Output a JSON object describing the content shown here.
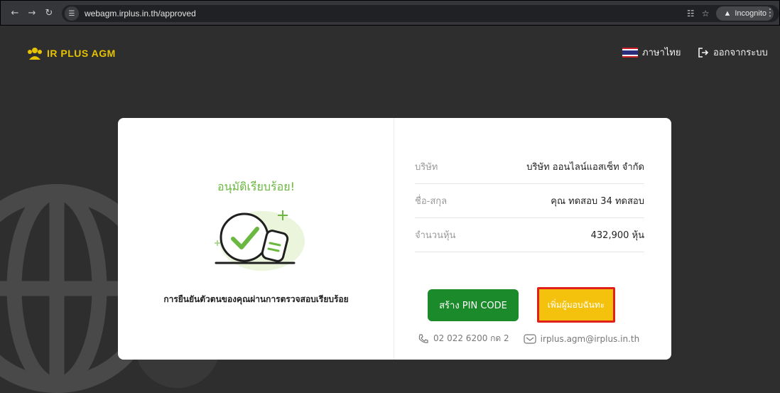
{
  "browser": {
    "url": "webagm.irplus.in.th/approved",
    "incognito_label": "Incognito"
  },
  "header": {
    "logo_text": "IR PLUS AGM",
    "language_label": "ภาษาไทย",
    "logout_label": "ออกจากระบบ",
    "brand_color": "#e6c200"
  },
  "card": {
    "success_title": "อนุมัติเรียบร้อย!",
    "verify_text": "การยืนยันตัวตนของคุณผ่านการตรวจสอบเรียบร้อย",
    "info": [
      {
        "label": "บริษัท",
        "value": "บริษัท ออนไลน์แอสเซ็ท จำกัด"
      },
      {
        "label": "ชื่อ-สกุล",
        "value": "คุณ ทดสอบ 34 ทดสอบ"
      },
      {
        "label": "จำนวนหุ้น",
        "value": "432,900 หุ้น"
      }
    ],
    "pin_button_label": "สร้าง PIN CODE",
    "proxy_button_label": "เพิ่มผู้มอบฉันทะ",
    "phone": "02 022 6200 กด 2",
    "email": "irplus.agm@irplus.in.th",
    "accent_green": "#1a8a2a",
    "accent_yellow": "#f4c20d",
    "highlight_red": "#e0201a"
  }
}
